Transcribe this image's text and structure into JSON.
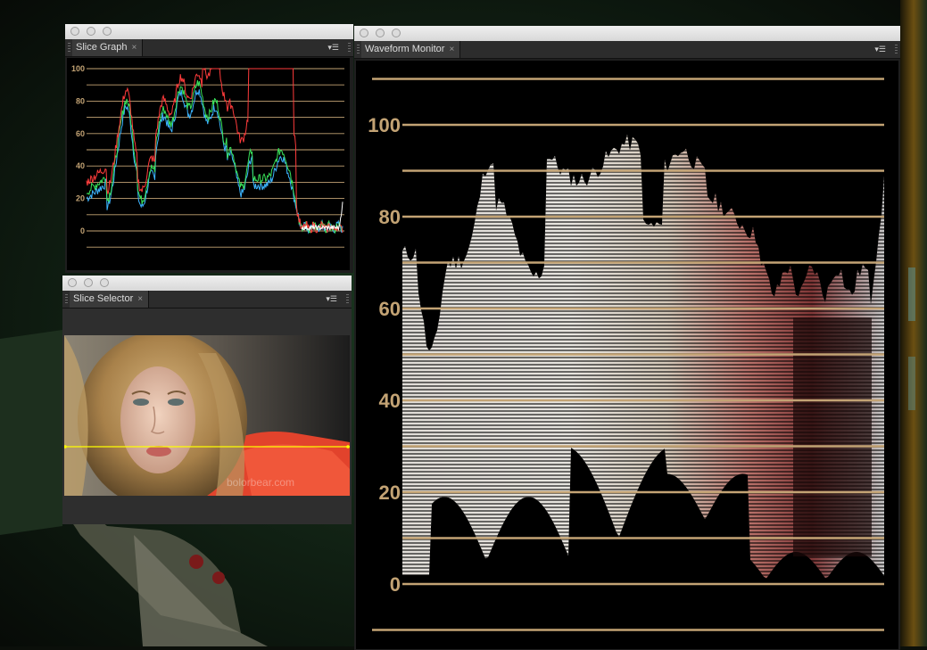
{
  "slice_graph": {
    "tab_label": "Slice Graph",
    "close_glyph": "×",
    "menu_glyph": "▾☰",
    "scale_labels": [
      "100",
      "80",
      "60",
      "40",
      "20",
      "0"
    ],
    "gridline_color": "#c3a374",
    "trace_colors": {
      "red": "#ff3b3b",
      "green": "#39e25a",
      "blue": "#3cb4ff",
      "white": "#ffffff"
    }
  },
  "slice_selector": {
    "tab_label": "Slice Selector",
    "close_glyph": "×",
    "menu_glyph": "▾☰",
    "watermark": "bolorbear.com",
    "slice_line_color": "#ffff00"
  },
  "waveform_monitor": {
    "tab_label": "Waveform Monitor",
    "close_glyph": "×",
    "menu_glyph": "▾☰",
    "scale_labels": [
      "100",
      "80",
      "60",
      "40",
      "20",
      "0"
    ],
    "label_color": "#c3a374"
  }
}
